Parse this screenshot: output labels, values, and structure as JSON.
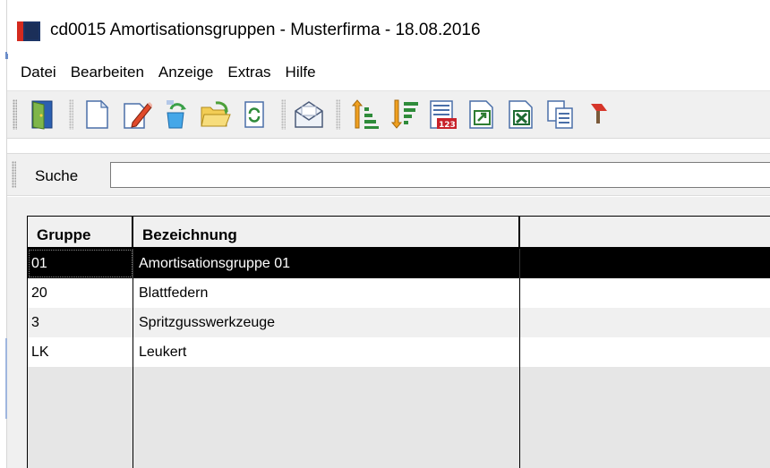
{
  "window": {
    "title": "cd0015 Amortisationsgruppen - Musterfirma - 18.08.2016"
  },
  "menu": {
    "items": [
      "Datei",
      "Bearbeiten",
      "Anzeige",
      "Extras",
      "Hilfe"
    ]
  },
  "toolbar": {
    "buttons": [
      "exit-door-icon",
      "new-document-icon",
      "edit-pencil-icon",
      "recycle-delete-icon",
      "open-folder-icon",
      "refresh-icon",
      "mail-icon",
      "sort-ascending-icon",
      "sort-descending-icon",
      "numeric-list-icon",
      "export-icon",
      "excel-export-icon",
      "copy-document-icon",
      "tool-icon"
    ]
  },
  "search": {
    "label": "Suche",
    "value": ""
  },
  "grid": {
    "columns": [
      "Gruppe",
      "Bezeichnung",
      ""
    ],
    "rows": [
      {
        "gruppe": "01",
        "bezeichnung": "Amortisationsgruppe 01",
        "selected": true
      },
      {
        "gruppe": "20",
        "bezeichnung": "Blattfedern",
        "selected": false
      },
      {
        "gruppe": "3",
        "bezeichnung": "Spritzgusswerkzeuge",
        "selected": false
      },
      {
        "gruppe": "LK",
        "bezeichnung": "Leukert",
        "selected": false
      }
    ]
  },
  "colors": {
    "selection": "#000000",
    "brand_red": "#d42a1e",
    "brand_navy": "#1d3566"
  }
}
